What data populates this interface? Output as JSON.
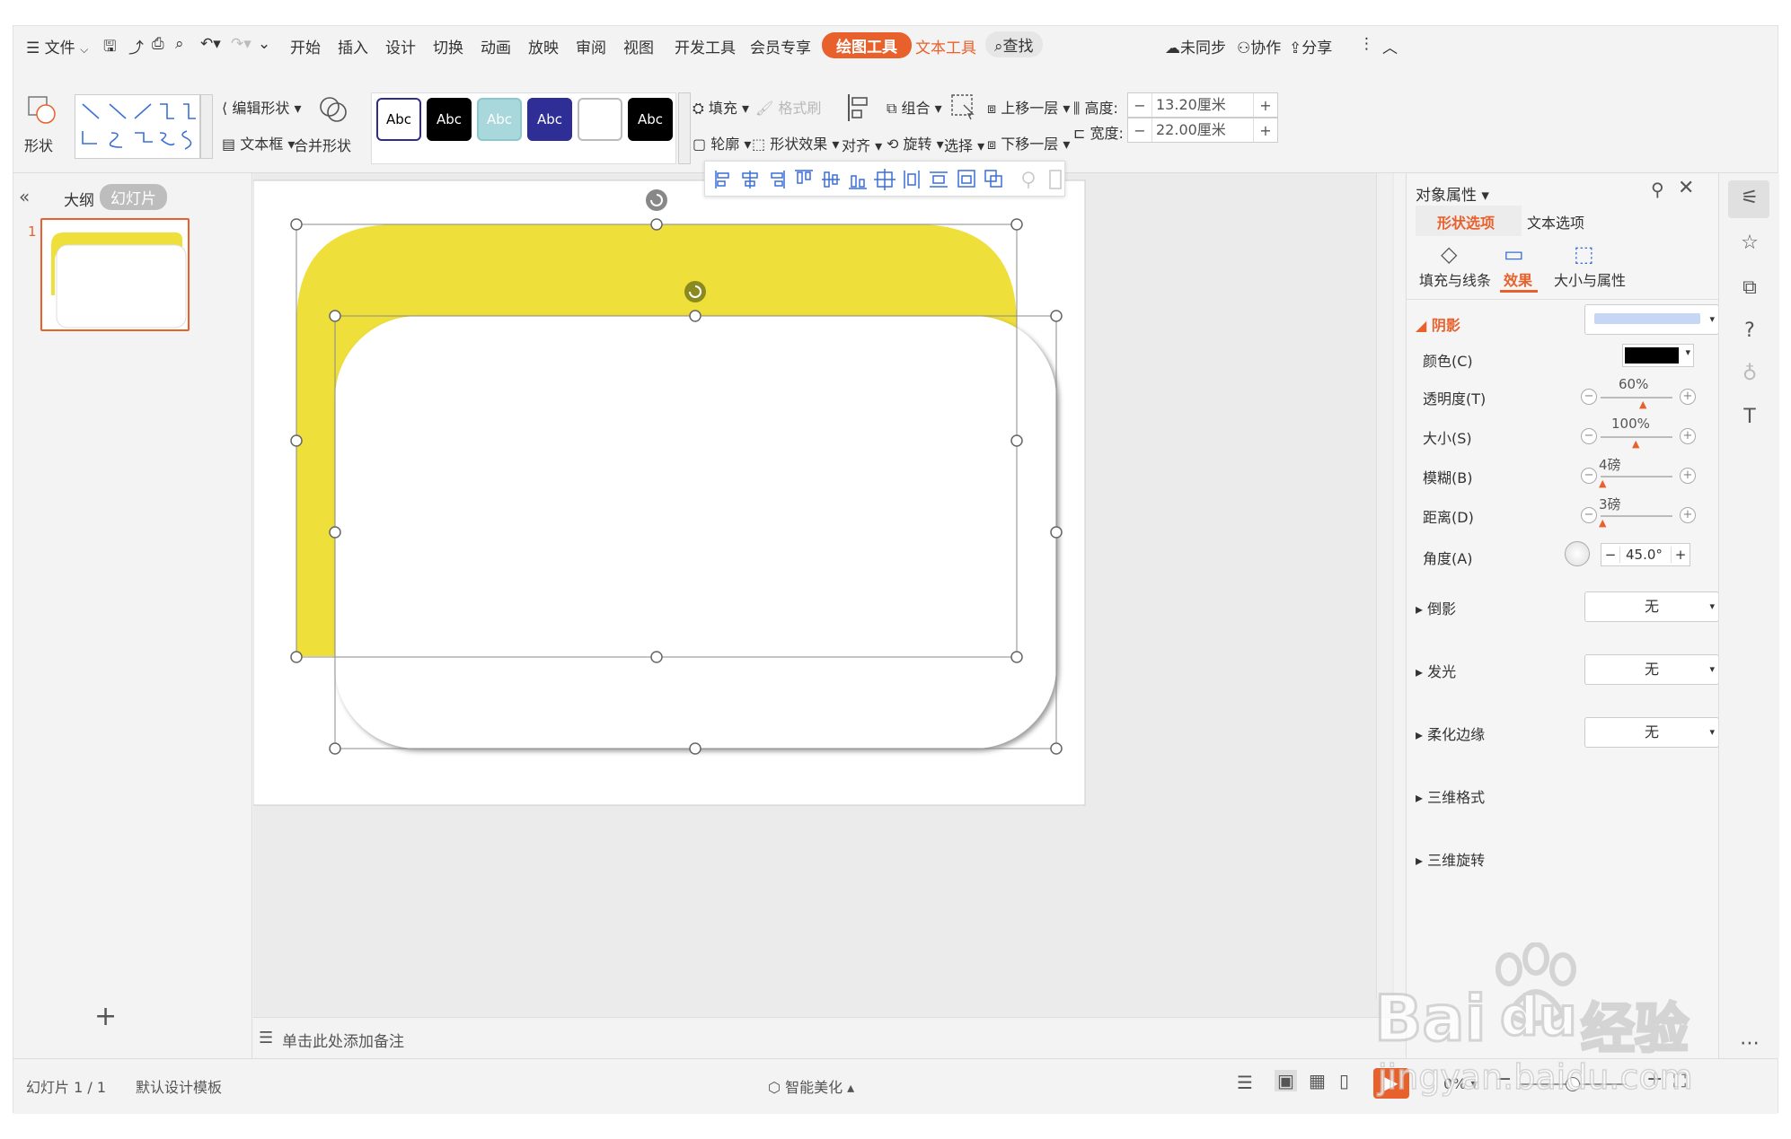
{
  "menubar": {
    "file_label": "文件",
    "tabs": [
      "开始",
      "插入",
      "设计",
      "切换",
      "动画",
      "放映",
      "审阅",
      "视图",
      "开发工具",
      "会员专享"
    ],
    "drawing_tools_tab": "绘图工具",
    "text_tools_tab": "文本工具",
    "search_label": "查找",
    "sync_label": "未同步",
    "collab_label": "协作",
    "share_label": "分享"
  },
  "ribbon": {
    "shape_label": "形状",
    "edit_shape_label": "编辑形状",
    "textbox_label": "文本框",
    "merge_shape_label": "合并形状",
    "style_samples": [
      {
        "label": "Abc",
        "bg": "#ffffff",
        "fg": "#000000",
        "border": "#2d2d8c"
      },
      {
        "label": "Abc",
        "bg": "#000000",
        "fg": "#ffffff",
        "border": "#000000"
      },
      {
        "label": "Abc",
        "bg": "#a8d8dc",
        "fg": "#ffffff",
        "border": "#8cc7cc"
      },
      {
        "label": "Abc",
        "bg": "#2e2e96",
        "fg": "#ffffff",
        "border": "#2e2e96"
      },
      {
        "label": "",
        "bg": "#ffffff",
        "fg": "#000000",
        "border": "#bbbbbb"
      },
      {
        "label": "Abc",
        "bg": "#000000",
        "fg": "#ffffff",
        "border": "#000000"
      }
    ],
    "fill_label": "填充",
    "format_brush_label": "格式刷",
    "outline_label": "轮廓",
    "shape_effect_label": "形状效果",
    "align_label": "对齐",
    "group_label": "组合",
    "rotate_label": "旋转",
    "select_label": "选择",
    "bring_forward_label": "上移一层",
    "send_backward_label": "下移一层",
    "height_label": "高度:",
    "height_value": "13.20厘米",
    "width_label": "宽度:",
    "width_value": "22.00厘米"
  },
  "leftpane": {
    "outline_tab": "大纲",
    "slides_tab": "幻灯片",
    "slide_number": "1",
    "add_slide": "+"
  },
  "canvas": {
    "notes_placeholder": "单击此处添加备注"
  },
  "rightpane": {
    "title": "对象属性",
    "tab_shape": "形状选项",
    "tab_text": "文本选项",
    "sub_fill": "填充与线条",
    "sub_effect": "效果",
    "sub_size": "大小与属性",
    "shadow_section": "阴影",
    "color_label": "颜色(C)",
    "transparency_label": "透明度(T)",
    "transparency_value": "60%",
    "transparency_frac": 0.6,
    "size_label": "大小(S)",
    "size_value": "100%",
    "size_frac": 0.5,
    "blur_label": "模糊(B)",
    "blur_value": "4磅",
    "distance_label": "距离(D)",
    "distance_value": "3磅",
    "angle_label": "角度(A)",
    "angle_value": "45.0°",
    "reflection_label": "倒影",
    "reflection_value": "无",
    "glow_label": "发光",
    "glow_value": "无",
    "soft_edge_label": "柔化边缘",
    "soft_edge_value": "无",
    "three_d_format": "三维格式",
    "three_d_rotation": "三维旋转"
  },
  "statusbar": {
    "slide_info": "幻灯片 1 / 1",
    "template": "默认设计模板",
    "smart_beautify": "智能美化",
    "zoom": "0%"
  },
  "watermark": {
    "text1": "Bai",
    "text2": "du",
    "text3": "经验",
    "url": "jingyan.baidu.com"
  },
  "colors": {
    "accent": "#e8612c",
    "shape_yellow": "#efdf3a"
  }
}
